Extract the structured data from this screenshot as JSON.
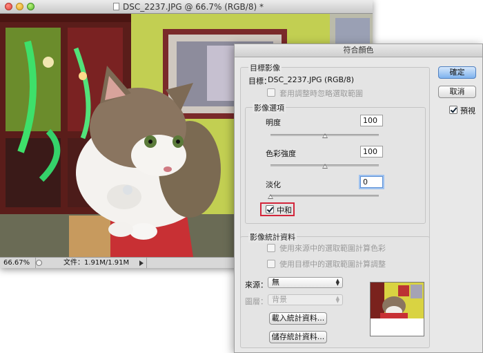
{
  "doc_window": {
    "title": "DSC_2237.JPG @ 66.7% (RGB/8) *",
    "status": {
      "zoom": "66.67%",
      "doc_info": "文件：1.91M/1.91M"
    }
  },
  "dialog": {
    "title": "符合顏色",
    "target_group": {
      "title": "目標影像",
      "target_label": "目標：",
      "target_value": "DSC_2237.JPG (RGB/8)",
      "ignore_selection_label": "套用調整時忽略選取範圍"
    },
    "image_options": {
      "title": "影像選項",
      "luminance": {
        "label": "明度",
        "value": "100",
        "level": 100
      },
      "color_intensity": {
        "label": "色彩強度",
        "value": "100",
        "level": 100
      },
      "fade": {
        "label": "淡化",
        "value": "0",
        "level": 0
      },
      "neutralize": {
        "label": "中和",
        "checked": true
      }
    },
    "image_statistics": {
      "title": "影像統計資料",
      "use_source_selection": "使用來源中的選取範圍計算色彩",
      "use_target_selection": "使用目標中的選取範圍計算調整",
      "source_label": "來源：",
      "source_value": "無",
      "layer_label": "圖層：",
      "layer_value": "背景",
      "load_stats": "載入統計資料...",
      "save_stats": "儲存統計資料..."
    },
    "buttons": {
      "ok": "確定",
      "cancel": "取消",
      "preview": "預視",
      "preview_checked": true
    }
  },
  "colors": {
    "highlight": "#d3253a",
    "default_button": "#7eb2ee",
    "wall": "#b9c94a"
  }
}
